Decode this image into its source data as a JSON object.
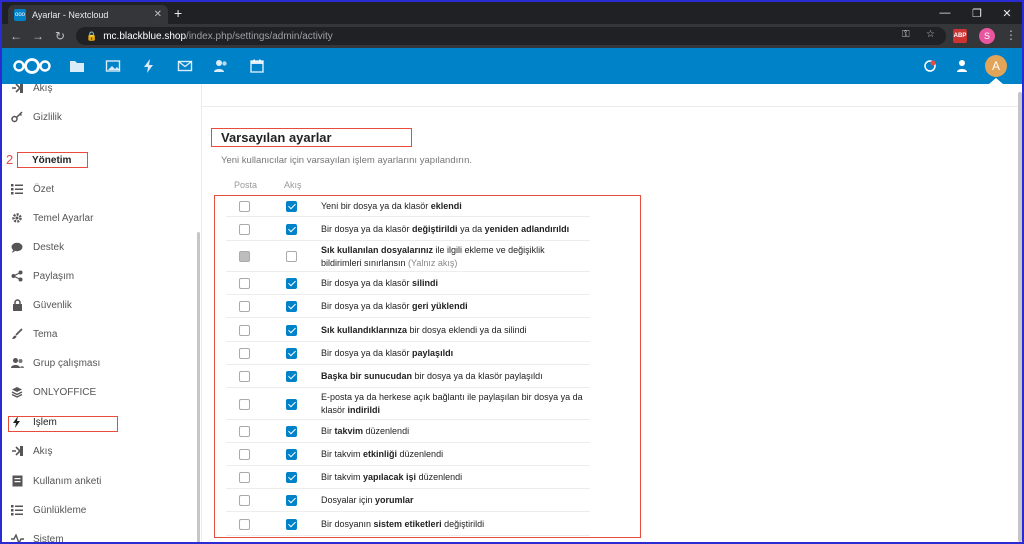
{
  "browser": {
    "tab_title": "Ayarlar - Nextcloud",
    "tab_close": "✕",
    "new_tab": "+",
    "favicon_text": "ooo",
    "url_host": "mc.blackblue.shop",
    "url_path": "/index.php/settings/admin/activity",
    "abp_label": "ABP",
    "profile_initial": "S",
    "win_min": "—",
    "win_max": "❐",
    "win_close": "✕"
  },
  "header": {
    "avatar_initial": "A",
    "brand_color": "#0082c9"
  },
  "sidebar": {
    "annotation_number": "2",
    "items": [
      {
        "label": "Akış",
        "icon": "activity-icon"
      },
      {
        "label": "Gizlilik",
        "icon": "key-icon"
      },
      {
        "label": "Yönetim",
        "icon": ""
      },
      {
        "label": "Özet",
        "icon": "list-icon"
      },
      {
        "label": "Temel Ayarlar",
        "icon": "gear-icon"
      },
      {
        "label": "Destek",
        "icon": "chat-bubble-icon"
      },
      {
        "label": "Paylaşım",
        "icon": "share-icon"
      },
      {
        "label": "Güvenlik",
        "icon": "lock-icon"
      },
      {
        "label": "Tema",
        "icon": "paintbrush-icon"
      },
      {
        "label": "Grup çalışması",
        "icon": "group-icon"
      },
      {
        "label": "ONLYOFFICE",
        "icon": "layers-icon"
      },
      {
        "label": "İşlem",
        "icon": "lightning-icon"
      },
      {
        "label": "Akış",
        "icon": "activity-icon"
      },
      {
        "label": "Kullanım anketi",
        "icon": "survey-icon"
      },
      {
        "label": "Günlükleme",
        "icon": "list-icon"
      },
      {
        "label": "Sistem",
        "icon": "pulse-icon"
      }
    ]
  },
  "main": {
    "title": "Varsayılan ayarlar",
    "description": "Yeni kullanıcılar için varsayılan işlem ayarlarını yapılandırın.",
    "col_mail": "Posta",
    "col_stream": "Akış",
    "rows": [
      {
        "pre": "Yeni bir dosya ya da klasör ",
        "b1": "eklendi",
        "mid": "",
        "b2": "",
        "post": "",
        "note": "",
        "mail": "off",
        "stream": "on"
      },
      {
        "pre": "Bir dosya ya da klasör ",
        "b1": "değiştirildi",
        "mid": " ya da ",
        "b2": "yeniden adlandırıldı",
        "post": "",
        "note": "",
        "mail": "off",
        "stream": "on"
      },
      {
        "pre": "",
        "b1": "Sık kullanılan dosyalarınız",
        "mid": " ile ilgili ekleme ve değişiklik bildirimleri sınırlansın",
        "b2": "",
        "post": "",
        "note": " (Yalnız akış)",
        "mail": "dis",
        "stream": "off"
      },
      {
        "pre": "Bir dosya ya da klasör ",
        "b1": "silindi",
        "mid": "",
        "b2": "",
        "post": "",
        "note": "",
        "mail": "off",
        "stream": "on"
      },
      {
        "pre": "Bir dosya ya da klasör ",
        "b1": "geri yüklendi",
        "mid": "",
        "b2": "",
        "post": "",
        "note": "",
        "mail": "off",
        "stream": "on"
      },
      {
        "pre": "",
        "b1": "Sık kullandıklarınıza",
        "mid": " bir dosya eklendi ya da silindi",
        "b2": "",
        "post": "",
        "note": "",
        "mail": "off",
        "stream": "on"
      },
      {
        "pre": "Bir dosya ya da klasör ",
        "b1": "paylaşıldı",
        "mid": "",
        "b2": "",
        "post": "",
        "note": "",
        "mail": "off",
        "stream": "on"
      },
      {
        "pre": "",
        "b1": "Başka bir sunucudan",
        "mid": " bir dosya ya da klasör paylaşıldı",
        "b2": "",
        "post": "",
        "note": "",
        "mail": "off",
        "stream": "on"
      },
      {
        "pre": "E-posta ya da herkese açık bağlantı ile paylaşılan bir dosya ya da klasör ",
        "b1": "indirildi",
        "mid": "",
        "b2": "",
        "post": "",
        "note": "",
        "mail": "off",
        "stream": "on"
      },
      {
        "pre": "Bir ",
        "b1": "takvim",
        "mid": " düzenlendi",
        "b2": "",
        "post": "",
        "note": "",
        "mail": "off",
        "stream": "on"
      },
      {
        "pre": "Bir takvim ",
        "b1": "etkinliği",
        "mid": " düzenlendi",
        "b2": "",
        "post": "",
        "note": "",
        "mail": "off",
        "stream": "on"
      },
      {
        "pre": "Bir takvim ",
        "b1": "yapılacak işi",
        "mid": " düzenlendi",
        "b2": "",
        "post": "",
        "note": "",
        "mail": "off",
        "stream": "on"
      },
      {
        "pre": "Dosyalar için ",
        "b1": "yorumlar",
        "mid": "",
        "b2": "",
        "post": "",
        "note": "",
        "mail": "off",
        "stream": "on"
      },
      {
        "pre": "Bir dosyanın ",
        "b1": "sistem etiketleri",
        "mid": " değiştirildi",
        "b2": "",
        "post": "",
        "note": "",
        "mail": "off",
        "stream": "on"
      }
    ]
  }
}
